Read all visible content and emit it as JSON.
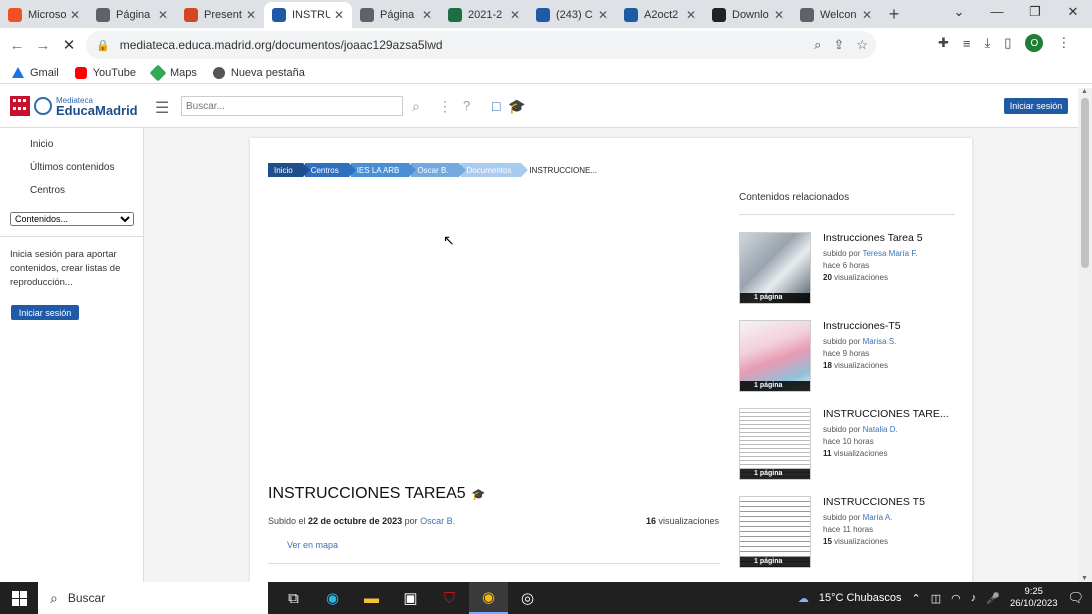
{
  "browser": {
    "tabs": [
      {
        "label": "Microso",
        "color": "#f25022",
        "fav": "windows-logo-icon"
      },
      {
        "label": "Página",
        "color": "#5f6368",
        "fav": "chrome-icon"
      },
      {
        "label": "Present",
        "color": "#d24726",
        "fav": "powerpoint-icon"
      },
      {
        "label": "INSTRU",
        "color": "#1f5aa6",
        "fav": "mortarboard-icon",
        "active": true
      },
      {
        "label": "Página",
        "color": "#5f6368",
        "fav": "chrome-icon"
      },
      {
        "label": "2021-2",
        "color": "#1d6f42",
        "fav": "excel-icon"
      },
      {
        "label": "(243) C",
        "color": "#1f5aa6",
        "fav": "mail-icon"
      },
      {
        "label": "A2oct2",
        "color": "#1f5aa6",
        "fav": "mortarboard-icon"
      },
      {
        "label": "Downlo",
        "color": "#222222",
        "fav": "github-icon"
      },
      {
        "label": "Welcon",
        "color": "#5f6368",
        "fav": "chrome-icon"
      }
    ],
    "url": "mediateca.educa.madrid.org/documentos/joaac129azsa5lwd",
    "bookmarks": [
      "Gmail",
      "YouTube",
      "Maps",
      "Nueva pestaña"
    ],
    "profile_initial": "O"
  },
  "header": {
    "logo_small": "Mediateca",
    "logo_big": "EducaMadrid",
    "search_placeholder": "Buscar...",
    "login_label": "Iniciar sesión"
  },
  "sidebar": {
    "nav": [
      "Inicio",
      "Últimos contenidos",
      "Centros"
    ],
    "select_value": "Contenidos...",
    "info": "Inicia sesión para aportar contenidos, crear listas de reproducción...",
    "login_label": "Iniciar sesión"
  },
  "breadcrumb": [
    {
      "label": "Inicio",
      "color": "#1f4e8c"
    },
    {
      "label": "Centros",
      "color": "#2e6fc0"
    },
    {
      "label": "IES LA ARB",
      "color": "#4a8ed4"
    },
    {
      "label": "Oscar B.",
      "color": "#74a9e0"
    },
    {
      "label": "Documentos",
      "color": "#a9cbef"
    },
    {
      "label": "INSTRUCCIONE...",
      "color": "transparent"
    }
  ],
  "related": {
    "title": "Contenidos relacionados",
    "items": [
      {
        "title": "Instrucciones Tarea 5",
        "by_prefix": "subido por",
        "author": "Teresa María F.",
        "when": "hace 6 horas",
        "views_num": "20",
        "views_label": "visualizaciones",
        "pages": "1 página",
        "thumb": "photo-laptop"
      },
      {
        "title": "Instrucciones-T5",
        "by_prefix": "subido por",
        "author": "Marisa S.",
        "when": "hace 9 horas",
        "views_num": "18",
        "views_label": "visualizaciones",
        "pages": "1 página",
        "thumb": "photo-flowers"
      },
      {
        "title": "INSTRUCCIONES TARE...",
        "by_prefix": "subido por",
        "author": "Natalia D.",
        "when": "hace 10 horas",
        "views_num": "11",
        "views_label": "visualizaciones",
        "pages": "1 página",
        "thumb": "text-doc"
      },
      {
        "title": "INSTRUCCIONES T5",
        "by_prefix": "subido por",
        "author": "María A.",
        "when": "hace 11 horas",
        "views_num": "15",
        "views_label": "visualizaciones",
        "pages": "1 página",
        "thumb": "text-doc-2"
      }
    ]
  },
  "document": {
    "title": "INSTRUCCIONES TAREA5",
    "uploaded_prefix": "Subido el",
    "uploaded_date": "22 de octubre de 2023",
    "uploaded_by_prefix": "por",
    "author": "Oscar B.",
    "views_num": "16",
    "views_label": "visualizaciones",
    "map_link": "Ver en mapa"
  },
  "taskbar": {
    "search_label": "Buscar",
    "weather": "15°C  Chubascos",
    "time": "9:25",
    "date": "26/10/2023"
  }
}
